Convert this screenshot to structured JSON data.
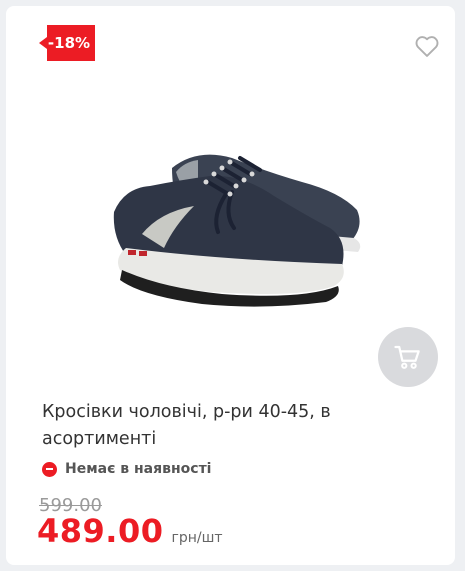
{
  "product": {
    "discount_badge": "-18%",
    "title": "Кросівки чоловічі, р-ри 40-45, в асортименті",
    "availability": "Немає в наявності",
    "old_price": "599.00",
    "price": "489.00",
    "unit": "грн/шт"
  },
  "icons": {
    "favorite": "heart-icon",
    "cart": "cart-icon",
    "stock_status": "minus-circle-icon"
  },
  "colors": {
    "accent": "#ec1c24",
    "cart_button": "#d9dadd",
    "old_price": "#9a9a9a"
  }
}
